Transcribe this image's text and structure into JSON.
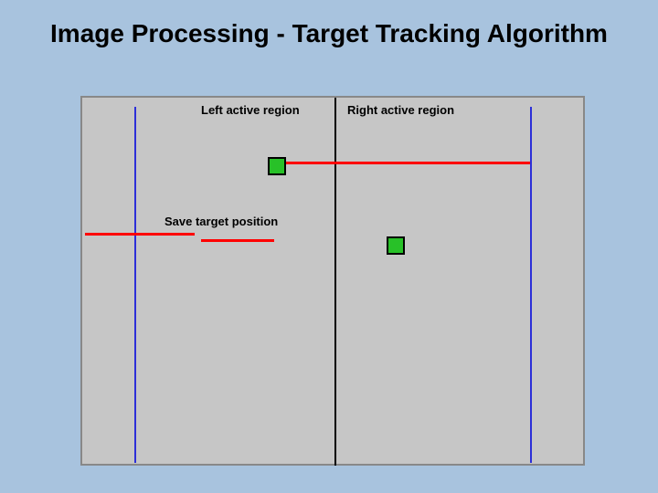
{
  "title": "Image Processing - Target Tracking Algorithm",
  "labels": {
    "left_region": "Left active region",
    "right_region": "Right active region",
    "save_position": "Save target position"
  }
}
